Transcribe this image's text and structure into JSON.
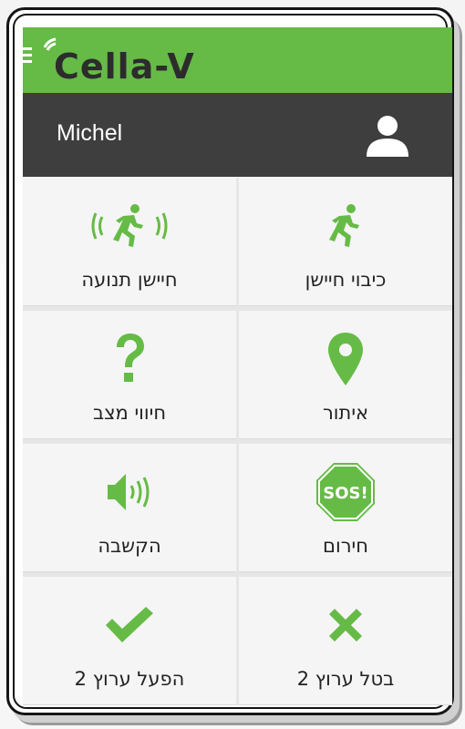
{
  "app": {
    "logo_text": "Cella-V",
    "brand_color": "#66bb46",
    "header_dark": "#3e3e3e"
  },
  "user": {
    "name": "Michel",
    "avatar_icon": "person-icon"
  },
  "menu": {
    "icon": "menu-icon"
  },
  "tiles": [
    {
      "label": "כיבוי חיישן",
      "icon": "running-person-icon"
    },
    {
      "label": "חיישן תנועה",
      "icon": "motion-sensor-icon"
    },
    {
      "label": "איתור",
      "icon": "location-pin-icon"
    },
    {
      "label": "חיווי מצב",
      "icon": "question-mark-icon"
    },
    {
      "label": "חירום",
      "icon": "sos-icon",
      "icon_text": "SOS!"
    },
    {
      "label": "הקשבה",
      "icon": "speaker-icon"
    },
    {
      "label": "בטל ערוץ 2",
      "icon": "cross-icon"
    },
    {
      "label": "הפעל ערוץ 2",
      "icon": "check-icon"
    }
  ]
}
